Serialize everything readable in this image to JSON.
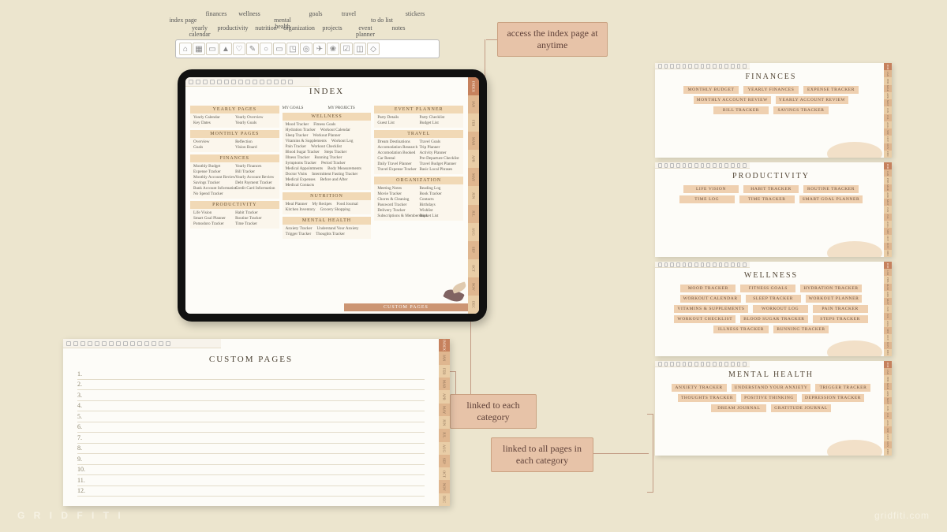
{
  "brand_left": "G R I D F I T I",
  "brand_right": "gridfiti.com",
  "toolbar_labels": [
    "index page",
    "yearly calendar",
    "finances",
    "productivity",
    "wellness",
    "nutrition",
    "mental health",
    "organization",
    "goals",
    "projects",
    "travel",
    "event planner",
    "to do list",
    "notes",
    "stickers"
  ],
  "callouts": {
    "index": "access the index page at anytime",
    "linked_cat": "linked to each category",
    "linked_all": "linked to all pages in each category"
  },
  "months": [
    "INDEX",
    "JAN",
    "FEB",
    "MAR",
    "APR",
    "MAY",
    "JUN",
    "JUL",
    "AUG",
    "SEP",
    "OCT",
    "NOV",
    "DEC"
  ],
  "index_title": "INDEX",
  "index": {
    "col1": [
      {
        "h": "YEARLY PAGES",
        "items": [
          "Yearly Calendar",
          "Yearly Overview",
          "Key Dates",
          "Yearly Goals"
        ]
      },
      {
        "h": "MONTHLY PAGES",
        "items": [
          "Overview",
          "Reflection",
          "Goals",
          "Vision Board"
        ]
      },
      {
        "h": "FINANCES",
        "items": [
          "Monthly Budget",
          "Yearly Finances",
          "Expense Tracker",
          "Bill Tracker",
          "Monthly Account Review",
          "Yearly Account Review",
          "Savings Tracker",
          "Debt Payment Tracker",
          "Bank Account Information",
          "Credit Card Information",
          "No Spend Tracker"
        ]
      },
      {
        "h": "PRODUCTIVITY",
        "items": [
          "Life Vision",
          "Habit Tracker",
          "Smart Goal Planner",
          "Routine Tracker",
          "Pomodoro Tracker",
          "Time Tracker"
        ]
      }
    ],
    "col2": [
      {
        "h": "MY GOALS",
        "items": []
      },
      {
        "h": "MY PROJECTS",
        "items": []
      },
      {
        "h": "WELLNESS",
        "items": [
          "Mood Tracker",
          "Fitness Goals",
          "Hydration Tracker",
          "Workout Calendar",
          "Sleep Tracker",
          "Workout Planner",
          "Vitamins & Supplements",
          "Workout Log",
          "Pain Tracker",
          "Workout Checklist",
          "Blood Sugar Tracker",
          "Steps Tracker",
          "Illness Tracker",
          "Running Tracker",
          "Symptoms Tracker",
          "Period Tracker",
          "Medical Appointments",
          "Body Measurements",
          "Doctor Visits",
          "Intermittent Fasting Tracker",
          "Medical Expenses",
          "Before and After",
          "Medical Contacts"
        ]
      },
      {
        "h": "NUTRITION",
        "items": [
          "Meal Planner",
          "My Recipes",
          "Food Journal",
          "Kitchen Inventory",
          "Grocery Shopping"
        ]
      },
      {
        "h": "MENTAL HEALTH",
        "items": [
          "Anxiety Tracker",
          "Understand Your Anxiety",
          "Trigger Tracker",
          "Thoughts Tracker"
        ]
      }
    ],
    "col3": [
      {
        "h": "EVENT PLANNER",
        "items": [
          "Party Details",
          "Party Checklist",
          "Guest List",
          "Budget List"
        ]
      },
      {
        "h": "TRAVEL",
        "items": [
          "Dream Destinations",
          "Travel Goals",
          "Accomodation Research",
          "Trip Planner",
          "Accomodation Booked",
          "Activity Planner",
          "Car Rental",
          "Pre-Departure Checklist",
          "Daily Travel Planner",
          "Travel Budget Planner",
          "Travel Expense Tracker",
          "Basic Local Phrases"
        ]
      },
      {
        "h": "ORGANIZATION",
        "items": [
          "Meeting Notes",
          "Reading Log",
          "Movie Tracker",
          "Book Tracker",
          "Chores & Cleaning",
          "Contacts",
          "Password Tracker",
          "Birthdays",
          "Delivery Tracker",
          "Wishlist",
          "Subscriptions & Memberships",
          "Bucket List"
        ]
      }
    ]
  },
  "custom_bar": "CUSTOM PAGES",
  "custom_sheet": {
    "title": "CUSTOM PAGES",
    "rows": [
      "1.",
      "2.",
      "3.",
      "4.",
      "5.",
      "6.",
      "7.",
      "8.",
      "9.",
      "10.",
      "11.",
      "12."
    ]
  },
  "mini": [
    {
      "title": "FINANCES",
      "chips": [
        "MONTHLY BUDGET",
        "YEARLY FINANCES",
        "EXPENSE TRACKER",
        "MONTHLY ACCOUNT REVIEW",
        "YEARLY ACCOUNT REVIEW",
        "BILL TRACKER",
        "SAVINGS TRACKER"
      ]
    },
    {
      "title": "PRODUCTIVITY",
      "chips": [
        "LIFE VISION",
        "HABIT TRACKER",
        "ROUTINE TRACKER",
        "TIME LOG",
        "TIME TRACKER",
        "SMART GOAL PLANNER"
      ]
    },
    {
      "title": "WELLNESS",
      "chips": [
        "MOOD TRACKER",
        "FITNESS GOALS",
        "HYDRATION TRACKER",
        "WORKOUT CALENDAR",
        "SLEEP TRACKER",
        "WORKOUT PLANNER",
        "VITAMINS & SUPPLEMENTS",
        "WORKOUT LOG",
        "PAIN TRACKER",
        "WORKOUT CHECKLIST",
        "BLOOD SUGAR TRACKER",
        "STEPS TRACKER",
        "ILLNESS TRACKER",
        "RUNNING TRACKER"
      ]
    },
    {
      "title": "MENTAL HEALTH",
      "chips": [
        "ANXIETY TRACKER",
        "UNDERSTAND YOUR ANXIETY",
        "TRIGGER TRACKER",
        "THOUGHTS TRACKER",
        "POSITIVE THINKING",
        "DEPRESSION TRACKER",
        "DREAM JOURNAL",
        "GRATITUDE JOURNAL"
      ]
    }
  ]
}
